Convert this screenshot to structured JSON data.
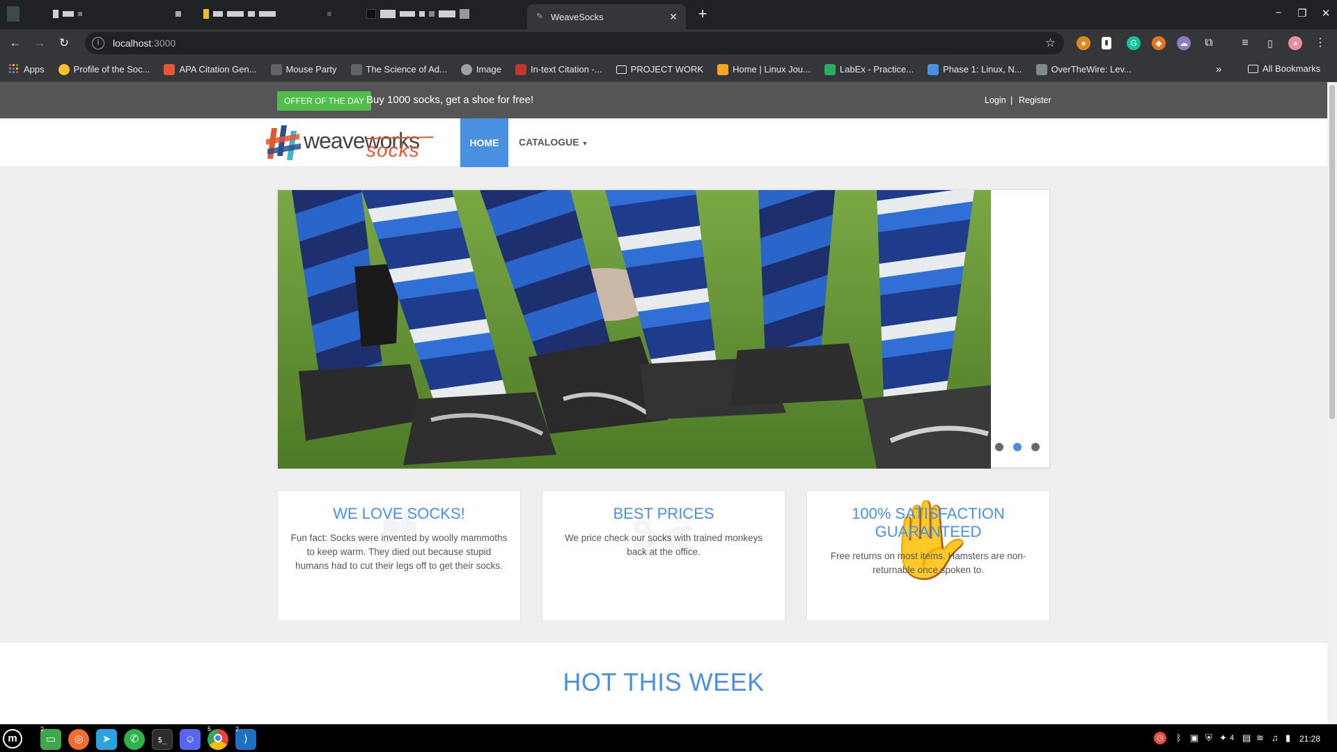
{
  "browser": {
    "active_tab_title": "WeaveSocks",
    "url_host": "localhost",
    "url_port": ":3000",
    "bookmarks": [
      {
        "label": "Apps",
        "icon": "apps-grid-icon",
        "color": "#e8453c"
      },
      {
        "label": "Profile of the Soc...",
        "icon": "emoji-glasses-icon",
        "color": "#f6c026"
      },
      {
        "label": "APA Citation Gen...",
        "icon": "citation-icon",
        "color": "#e4572e"
      },
      {
        "label": "Mouse Party",
        "icon": "mouse-icon",
        "color": "#5f6368"
      },
      {
        "label": "The Science of Ad...",
        "icon": "science-icon",
        "color": "#5f6368"
      },
      {
        "label": "Image",
        "icon": "globe-icon",
        "color": "#9aa0a6"
      },
      {
        "label": "In-text Citation -...",
        "icon": "citation-red-icon",
        "color": "#c0392b"
      },
      {
        "label": "PROJECT WORK",
        "icon": "folder-icon",
        "color": "#35363a"
      },
      {
        "label": "Home | Linux Jou...",
        "icon": "linux-icon",
        "color": "#f4a623"
      },
      {
        "label": "LabEx - Practice...",
        "icon": "labex-icon",
        "color": "#27ae60"
      },
      {
        "label": "Phase 1: Linux, N...",
        "icon": "phase-icon",
        "color": "#4a90e2"
      },
      {
        "label": "OverTheWire: Lev...",
        "icon": "overthewire-icon",
        "color": "#7f8c8d"
      }
    ],
    "all_bookmarks_label": "All Bookmarks",
    "more_glyph": "»"
  },
  "site": {
    "offer_badge": "OFFER OF THE DAY",
    "offer_text": "Buy 1000 socks, get a shoe for free!",
    "login": "Login",
    "separator": "|",
    "register": "Register",
    "logo_word1": "weaveworks",
    "logo_word2": "socks",
    "nav_home": "HOME",
    "nav_catalogue": "CATALOGUE",
    "carousel_active_dot": 2,
    "carousel_dot_count": 3,
    "features": [
      {
        "title": "WE LOVE SOCKS!",
        "text": "Fun fact: Socks were invented by woolly mammoths to keep warm. They died out because stupid humans had to cut their legs off to get their socks."
      },
      {
        "title": "BEST PRICES",
        "text": "We price check our socks with trained monkeys back at the office."
      },
      {
        "title": "100% SATISFACTION GUARANTEED",
        "text": "Free returns on most items. Hamsters are non-returnable once spoken to."
      }
    ],
    "hot_heading": "HOT THIS WEEK"
  },
  "taskbar": {
    "clock": "21:28",
    "volume_level": "4",
    "badges": {
      "files": "2",
      "chrome": "5",
      "vscode": "2"
    }
  },
  "colors": {
    "accent": "#4a90e2",
    "offer_green": "#4fbf4a",
    "topbar": "#555555",
    "logo_orange": "#e4572e"
  }
}
